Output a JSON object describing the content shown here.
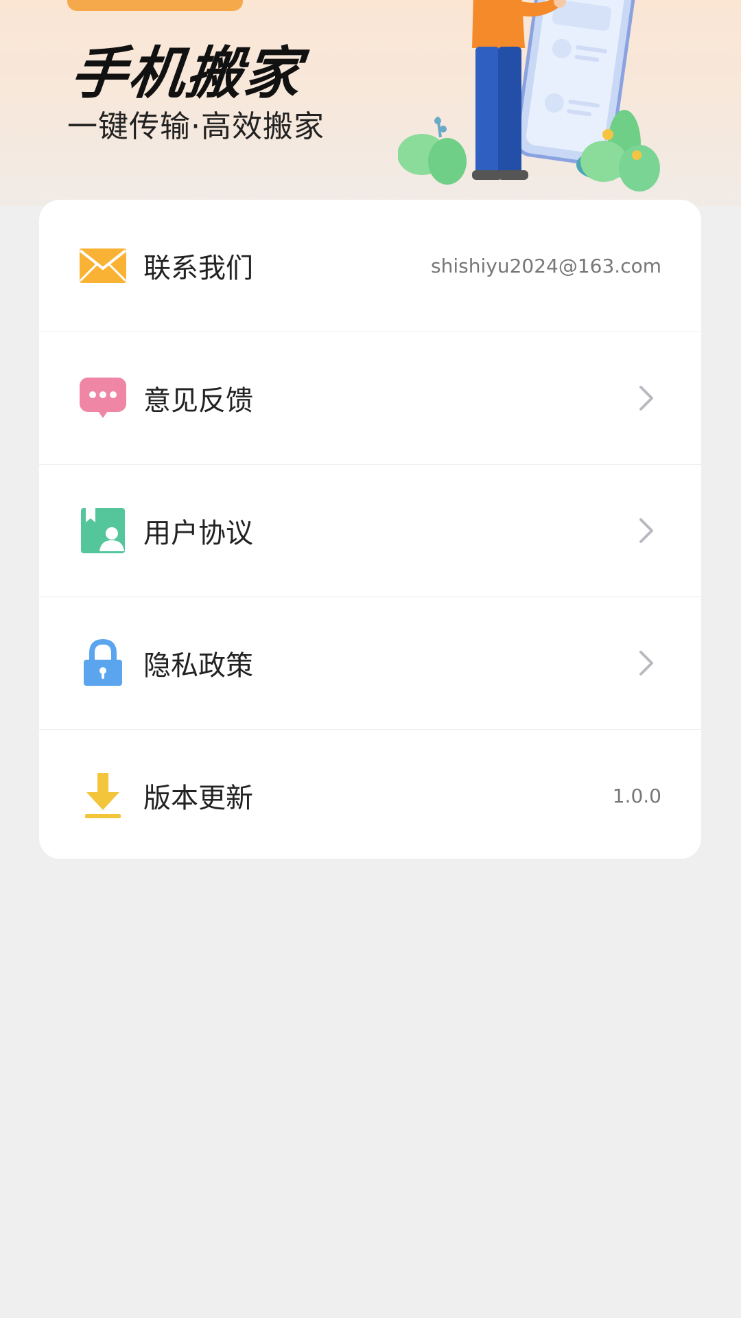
{
  "header": {
    "title": "手机搬家",
    "subtitle": "一键传输·高效搬家"
  },
  "menu": {
    "items": [
      {
        "label": "联系我们",
        "value": "shishiyu2024@163.com",
        "icon": "mail-icon",
        "icon_color": "#f9b233"
      },
      {
        "label": "意见反馈",
        "icon": "feedback-icon",
        "icon_color": "#ef86a6"
      },
      {
        "label": "用户协议",
        "icon": "user-agreement-icon",
        "icon_color": "#55c59b"
      },
      {
        "label": "隐私政策",
        "icon": "lock-icon",
        "icon_color": "#5ba4ee"
      },
      {
        "label": "版本更新",
        "value": "1.0.0",
        "icon": "download-icon",
        "icon_color": "#f3c53a"
      }
    ]
  },
  "colors": {
    "background": "#efefef",
    "card": "#ffffff",
    "accent": "#f6a94a"
  }
}
